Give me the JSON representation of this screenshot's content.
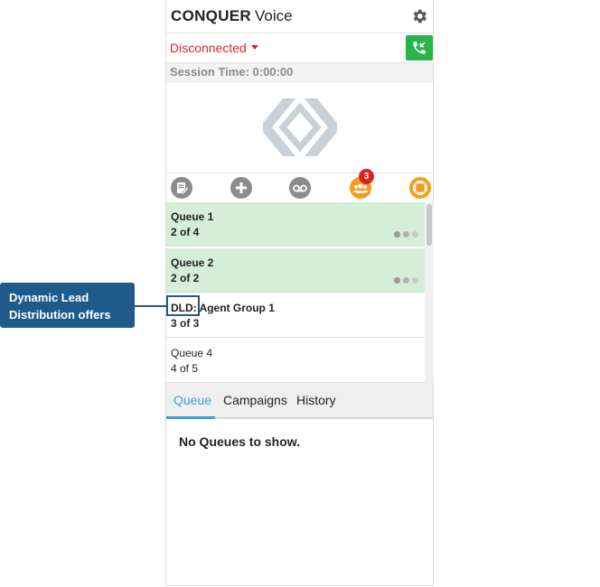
{
  "header": {
    "brand_bold": "CONQUER",
    "brand_light": "Voice"
  },
  "status": {
    "label": "Disconnected"
  },
  "session": {
    "label": "Session Time: 0:00:00"
  },
  "toolbar": {
    "icons": [
      "notes-icon",
      "add-icon",
      "voicemail-icon",
      "queue-group-icon",
      "help-icon"
    ],
    "badge_count": "3"
  },
  "queues": [
    {
      "name": "Queue 1",
      "count": "2 of 4",
      "highlighted": true
    },
    {
      "name": "Queue 2",
      "count": "2 of 2",
      "highlighted": true
    },
    {
      "prefix": "DLD:",
      "name": "Agent Group 1",
      "count": "3 of 3",
      "highlighted": false
    },
    {
      "name": "Queue 4",
      "count": "4 of 5",
      "highlighted": false
    }
  ],
  "tabs": [
    {
      "label": "Queue",
      "active": true
    },
    {
      "label": "Campaigns",
      "active": false
    },
    {
      "label": "History",
      "active": false
    }
  ],
  "empty_message": "No Queues to show.",
  "callout": {
    "line1": "Dynamic Lead",
    "line2": "Distribution offers"
  },
  "colors": {
    "status_red": "#d9262c",
    "call_green": "#28b34b",
    "row_green": "#d4eed8",
    "tab_blue": "#3aa3d3",
    "callout_blue": "#1e5a8a",
    "badge_orange": "#f59c1a"
  }
}
